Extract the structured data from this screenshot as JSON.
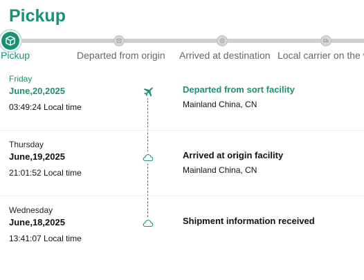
{
  "header": {
    "title": "Pickup"
  },
  "stepper": {
    "steps": [
      {
        "label": "Pickup",
        "state": "active",
        "icon": "package-icon"
      },
      {
        "label": "Departed from origin",
        "state": "pending",
        "icon": "departed-icon"
      },
      {
        "label": "Arrived at destination",
        "state": "pending",
        "icon": "arrived-icon"
      },
      {
        "label": "Local carrier on the w",
        "state": "pending",
        "icon": "truck-icon"
      }
    ]
  },
  "events": [
    {
      "weekday": "Friday",
      "date": "June,20,2025",
      "time": "03:49:24 Local time",
      "title": "Departed from sort facility",
      "location": "Mainland China, CN",
      "icon": "airplane-icon",
      "latest": true
    },
    {
      "weekday": "Thursday",
      "date": "June,19,2025",
      "time": "21:01:52 Local time",
      "title": "Arrived at origin facility",
      "location": "Mainland China, CN",
      "icon": "cloud-icon",
      "latest": false
    },
    {
      "weekday": "Wednesday",
      "date": "June,18,2025",
      "time": "13:41:07 Local time",
      "title": "Shipment information received",
      "location": "",
      "icon": "cloud-icon",
      "latest": false
    }
  ],
  "colors": {
    "accent": "#1a9175",
    "track": "#cfcfcf",
    "pending_node": "#d6d6d6",
    "divider": "#ececec"
  }
}
